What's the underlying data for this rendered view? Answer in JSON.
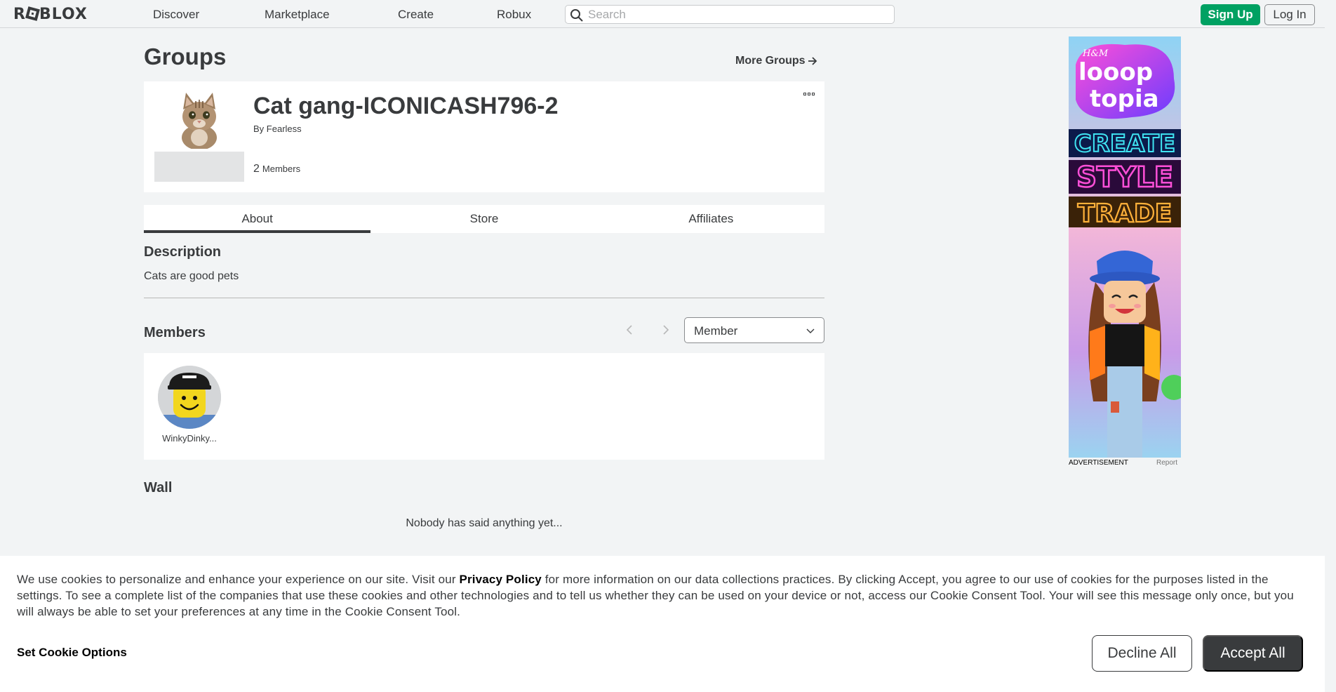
{
  "header": {
    "logo_left": "R",
    "logo_right": "BLOX",
    "nav": [
      "Discover",
      "Marketplace",
      "Create",
      "Robux"
    ],
    "search_placeholder": "Search",
    "signup_label": "Sign Up",
    "login_label": "Log In"
  },
  "page": {
    "title": "Groups",
    "more_groups": "More Groups"
  },
  "group": {
    "name": "Cat gang-ICONICASH796-2",
    "by_label": "By",
    "owner": "Fearless",
    "member_count": "2",
    "members_label": "Members"
  },
  "tabs": [
    {
      "label": "About",
      "active": true
    },
    {
      "label": "Store",
      "active": false
    },
    {
      "label": "Affiliates",
      "active": false
    }
  ],
  "description": {
    "heading": "Description",
    "text": "Cats are good pets"
  },
  "members": {
    "heading": "Members",
    "role_selected": "Member",
    "list": [
      {
        "name": "WinkyDinky..."
      }
    ]
  },
  "wall": {
    "heading": "Wall",
    "empty_text": "Nobody has said anything yet..."
  },
  "ad": {
    "label": "ADVERTISEMENT",
    "report": "Report",
    "brand": "H&M",
    "line1": "looop",
    "line2": "topia",
    "word1": "CREATE",
    "word2": "STYLE",
    "word3": "TRADE"
  },
  "cookie": {
    "text_before": "We use cookies to personalize and enhance your experience on our site. Visit our ",
    "policy_link": "Privacy Policy",
    "text_after": " for more information on our data collections practices. By clicking Accept, you agree to our use of cookies for the purposes listed in the settings. To see a complete list of the companies that use these cookies and other technologies and to tell us whether they can be used on your device or not, access our Cookie Consent Tool. Your will see this message only once, but you will always be able to set your preferences at any time in the Cookie Consent Tool.",
    "options_label": "Set Cookie Options",
    "decline_label": "Decline All",
    "accept_label": "Accept All"
  },
  "colors": {
    "accent_green": "#00a162",
    "text_dark": "#393b3d",
    "background": "#f2f4f5"
  }
}
